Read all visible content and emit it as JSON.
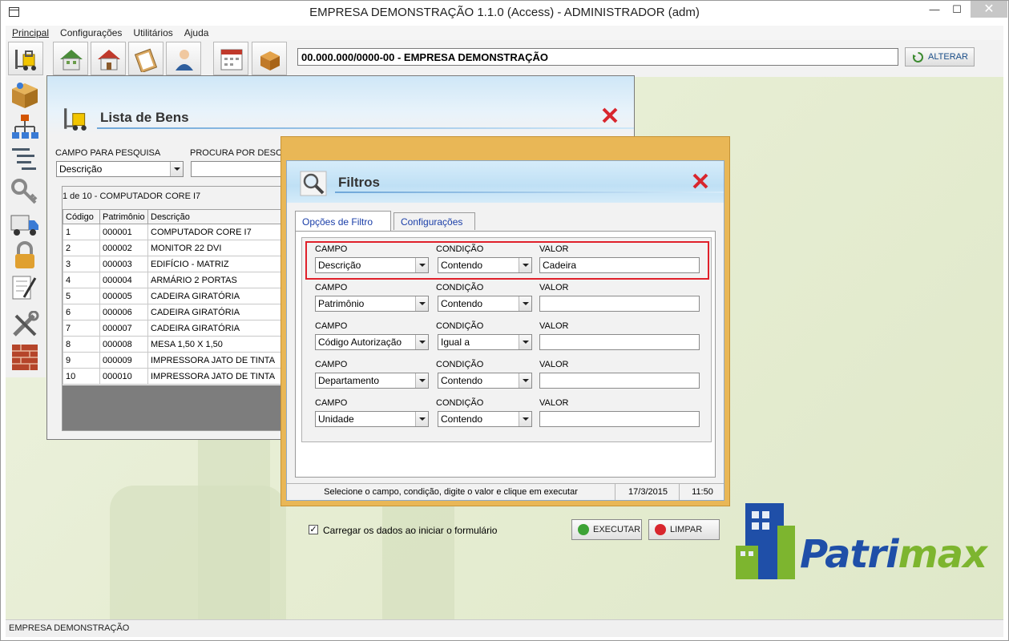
{
  "window": {
    "title": "EMPRESA DEMONSTRAÇÃO 1.1.0 (Access) - ADMINISTRADOR (adm)",
    "minimize": "—",
    "maximize": "☐",
    "close": "✕"
  },
  "menu": [
    "Principal",
    "Configurações",
    "Utilitários",
    "Ajuda"
  ],
  "toolbar": {
    "company": "00.000.000/0000-00 - EMPRESA DEMONSTRAÇÃO",
    "alterar_label": "ALTERAR"
  },
  "lista_bens": {
    "title": "Lista de Bens",
    "campo_label": "CAMPO PARA PESQUISA",
    "campo_value": "Descrição",
    "procura_label": "PROCURA POR DESCRI",
    "record_position": "1 de 10 - COMPUTADOR CORE I7",
    "columns": [
      "Código",
      "Patrimônio",
      "Descrição"
    ],
    "rows": [
      [
        "1",
        "000001",
        "COMPUTADOR CORE I7"
      ],
      [
        "2",
        "000002",
        "MONITOR 22 DVI"
      ],
      [
        "3",
        "000003",
        "EDIFÍCIO - MATRIZ"
      ],
      [
        "4",
        "000004",
        "ARMÁRIO 2 PORTAS"
      ],
      [
        "5",
        "000005",
        "CADEIRA GIRATÓRIA"
      ],
      [
        "6",
        "000006",
        "CADEIRA GIRATÓRIA"
      ],
      [
        "7",
        "000007",
        "CADEIRA GIRATÓRIA"
      ],
      [
        "8",
        "000008",
        "MESA 1,50 X 1,50"
      ],
      [
        "9",
        "000009",
        "IMPRESSORA JATO DE TINTA"
      ],
      [
        "10",
        "000010",
        "IMPRESSORA JATO DE TINTA"
      ]
    ]
  },
  "filtros": {
    "title": "Filtros",
    "tabs": [
      "Opções de Filtro",
      "Configurações"
    ],
    "labels": {
      "campo": "CAMPO",
      "condicao": "CONDIÇÃO",
      "valor": "VALOR"
    },
    "rows": [
      {
        "campo": "Descrição",
        "condicao": "Contendo",
        "valor": "Cadeira"
      },
      {
        "campo": "Patrimônio",
        "condicao": "Contendo",
        "valor": ""
      },
      {
        "campo": "Código Autorização",
        "condicao": "Igual a",
        "valor": ""
      },
      {
        "campo": "Departamento",
        "condicao": "Contendo",
        "valor": ""
      },
      {
        "campo": "Unidade",
        "condicao": "Contendo",
        "valor": ""
      }
    ],
    "checkbox_label": "Carregar os dados ao iniciar o formulário",
    "checkbox_checked": true,
    "executar_label": "EXECUTAR",
    "limpar_label": "LIMPAR",
    "status_hint": "Selecione o campo, condição, digite o valor e clique em executar",
    "status_date": "17/3/2015",
    "status_time": "11:50"
  },
  "statusbar": {
    "text": "EMPRESA DEMONSTRAÇÃO"
  },
  "logo": {
    "text_blue": "Patri",
    "text_green": "max"
  },
  "colors": {
    "accent_blue": "#1f4fa8",
    "logo_green": "#7db52f",
    "highlight_red": "#e0202a",
    "dialog_frame": "#e9b756"
  }
}
